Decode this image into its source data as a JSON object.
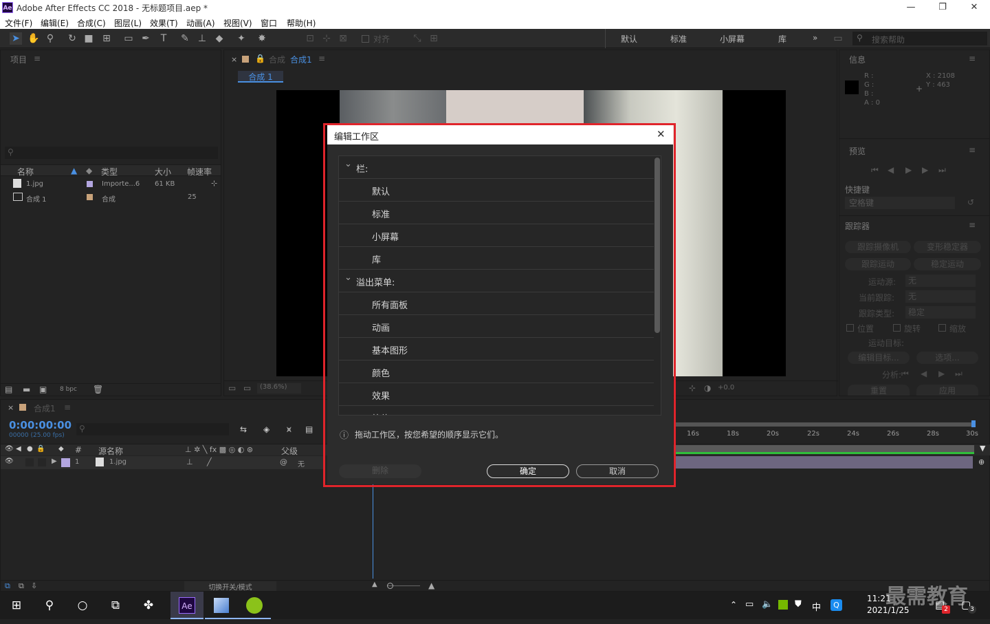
{
  "window": {
    "app_icon": "Ae",
    "title": "Adobe After Effects CC 2018 - 无标题项目.aep *",
    "minimize": "—",
    "maximize": "❐",
    "close": "✕"
  },
  "menu": [
    "文件(F)",
    "编辑(E)",
    "合成(C)",
    "图层(L)",
    "效果(T)",
    "动画(A)",
    "视图(V)",
    "窗口",
    "帮助(H)"
  ],
  "toolbar": {
    "align_label": "对齐",
    "workspaces": [
      "默认",
      "标准",
      "小屏幕",
      "库"
    ],
    "overflow": "»",
    "search_placeholder": "搜索帮助"
  },
  "project_panel": {
    "title": "项目",
    "columns": {
      "name": "名称",
      "type": "类型",
      "size": "大小",
      "fps": "帧速率"
    },
    "items": [
      {
        "name": "1.jpg",
        "type": "Importe...6",
        "size": "61 KB",
        "fps": ""
      },
      {
        "name": "合成 1",
        "type": "合成",
        "size": "",
        "fps": "25"
      }
    ],
    "bpc": "8 bpc"
  },
  "comp_panel": {
    "tab_prefix": "合成",
    "tab": "合成1",
    "subtab": "合成 1",
    "zoom": "(38.6%)",
    "exposure": "+0.0"
  },
  "info_panel": {
    "title": "信息",
    "r": "R :",
    "g": "G :",
    "b": "B :",
    "a": "A : 0",
    "x": "X : 2108",
    "y": "Y : 463"
  },
  "preview_panel": {
    "title": "预览",
    "shortcut_label": "快捷键",
    "shortcut_value": "空格键"
  },
  "tracker_panel": {
    "title": "跟踪器",
    "track_camera": "跟踪摄像机",
    "warp_stabilizer": "变形稳定器",
    "track_motion": "跟踪运动",
    "stabilize_motion": "稳定运动",
    "motion_source_label": "运动源:",
    "motion_source": "无",
    "current_track_label": "当前跟踪:",
    "current_track": "无",
    "track_type_label": "跟踪类型:",
    "track_type": "稳定",
    "position": "位置",
    "rotation": "旋转",
    "scale": "缩放",
    "motion_target_label": "运动目标:",
    "edit_target": "编辑目标...",
    "options": "选项...",
    "analyze_label": "分析:",
    "reset": "重置",
    "apply": "应用"
  },
  "timeline": {
    "tab": "合成1",
    "timecode": "0:00:00:00",
    "frame_info": "00000 (25.00 fps)",
    "col_num": "#",
    "col_source": "源名称",
    "col_parent": "父级",
    "layer": {
      "index": "1",
      "name": "1.jpg",
      "parent": "无"
    },
    "ruler": [
      "16s",
      "18s",
      "20s",
      "22s",
      "24s",
      "26s",
      "28s",
      "30s"
    ],
    "toggle_label": "切换开关/模式"
  },
  "dialog": {
    "title": "编辑工作区",
    "close": "✕",
    "rows": [
      {
        "label": "栏:",
        "group": true
      },
      {
        "label": "默认",
        "group": false
      },
      {
        "label": "标准",
        "group": false
      },
      {
        "label": "小屏幕",
        "group": false
      },
      {
        "label": "库",
        "group": false
      },
      {
        "label": "溢出菜单:",
        "group": true
      },
      {
        "label": "所有面板",
        "group": false
      },
      {
        "label": "动画",
        "group": false
      },
      {
        "label": "基本图形",
        "group": false
      },
      {
        "label": "颜色",
        "group": false
      },
      {
        "label": "效果",
        "group": false
      },
      {
        "label": "简约",
        "group": false
      }
    ],
    "hint": "拖动工作区，按您希望的顺序显示它们。",
    "delete": "删除",
    "ok": "确定",
    "cancel": "取消",
    "highlight_color": "#e0242b"
  },
  "taskbar": {
    "time": "11:21",
    "date": "2021/1/25",
    "ime": "中",
    "watermark": "最需教育",
    "notify_count": "3",
    "badge_count": "2"
  }
}
